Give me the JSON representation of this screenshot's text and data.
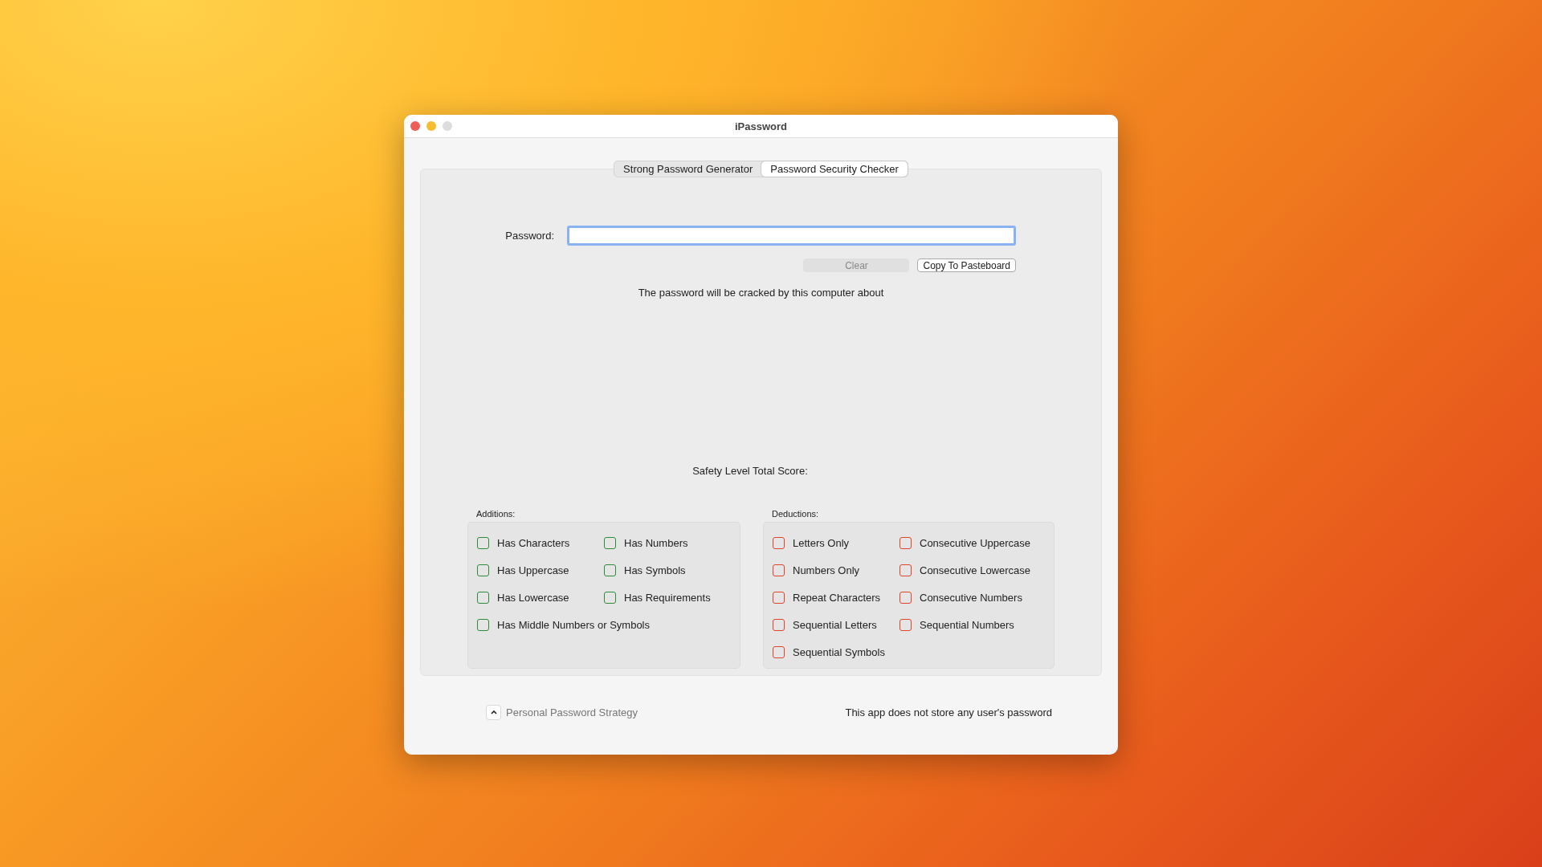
{
  "window": {
    "title": "iPassword"
  },
  "tabs": [
    {
      "label": "Strong Password Generator",
      "selected": false
    },
    {
      "label": "Password Security Checker",
      "selected": true
    }
  ],
  "password": {
    "label": "Password:"
  },
  "buttons": [
    {
      "label": "Clear",
      "disabled": true
    },
    {
      "label": "Copy To Pasteboard",
      "disabled": false
    }
  ],
  "crack_message": "The password will be cracked by this computer about",
  "score_label": "Safety Level Total Score:",
  "groups": [
    {
      "label": "Additions:",
      "color": "#2e8b3a",
      "items": [
        {
          "label": "Has Characters",
          "checked": false
        },
        {
          "label": "Has Numbers",
          "checked": false
        },
        {
          "label": "Has Uppercase",
          "checked": false
        },
        {
          "label": "Has Symbols",
          "checked": false
        },
        {
          "label": "Has Lowercase",
          "checked": false
        },
        {
          "label": "Has Requirements",
          "checked": false
        },
        {
          "label": "Has Middle Numbers or Symbols",
          "checked": false
        }
      ]
    },
    {
      "label": "Deductions:",
      "color": "#e0442a",
      "items": [
        {
          "label": "Letters Only",
          "checked": false
        },
        {
          "label": "Consecutive Uppercase",
          "checked": false
        },
        {
          "label": "Numbers Only",
          "checked": false
        },
        {
          "label": "Consecutive Lowercase",
          "checked": false
        },
        {
          "label": "Repeat Characters",
          "checked": false
        },
        {
          "label": "Consecutive Numbers",
          "checked": false
        },
        {
          "label": "Sequential Letters",
          "checked": false
        },
        {
          "label": "Sequential Numbers",
          "checked": false
        },
        {
          "label": "Sequential Symbols",
          "checked": false
        }
      ]
    }
  ],
  "footer": {
    "disclosure": {
      "label": "Personal Password Strategy",
      "expanded": false
    },
    "note": "This app does not store any user's password"
  }
}
